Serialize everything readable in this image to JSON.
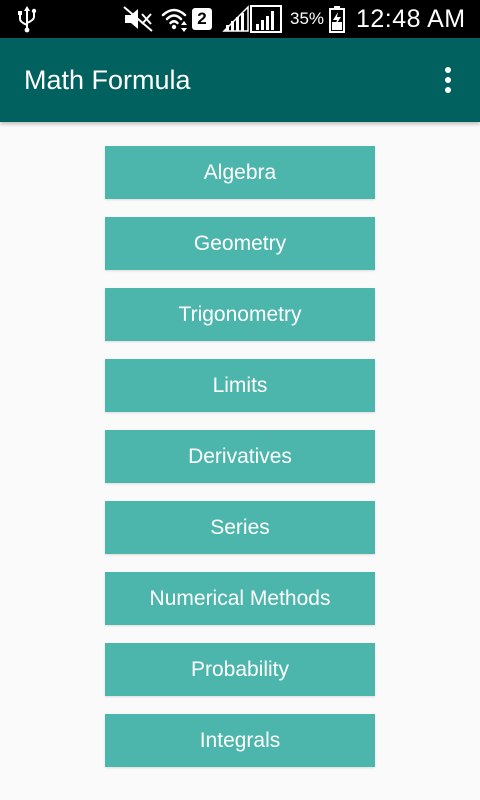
{
  "status_bar": {
    "sim_slot": "2",
    "battery_percent": "35%",
    "time": "12:48 AM",
    "icons": [
      "usb-icon",
      "mute-icon",
      "wifi-icon",
      "signal-icon",
      "battery-icon"
    ]
  },
  "app_bar": {
    "title": "Math Formula",
    "overflow_icon": "more-vert-icon"
  },
  "menu": [
    {
      "label": "Algebra"
    },
    {
      "label": "Geometry"
    },
    {
      "label": "Trigonometry"
    },
    {
      "label": "Limits"
    },
    {
      "label": "Derivatives"
    },
    {
      "label": "Series"
    },
    {
      "label": "Numerical Methods"
    },
    {
      "label": "Probability"
    },
    {
      "label": "Integrals"
    }
  ],
  "colors": {
    "status_bar": "#000000",
    "app_bar": "#00615f",
    "button": "#4db6ac",
    "background": "#fafafa",
    "text_light": "#ffffff"
  }
}
